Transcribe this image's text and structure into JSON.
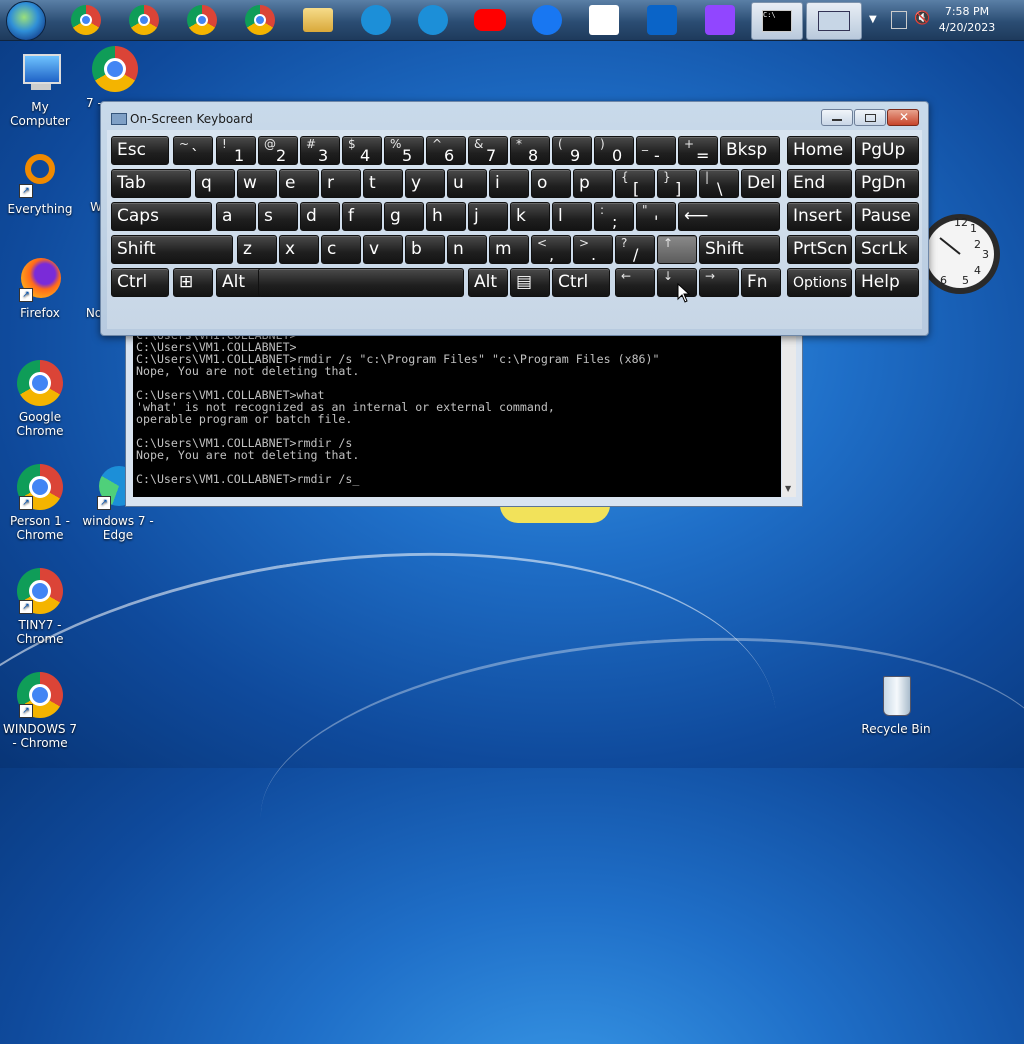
{
  "taskbar": {
    "clock_time": "7:58 PM",
    "clock_date": "4/20/2023",
    "pinned": [
      {
        "name": "chrome",
        "color": "#4285f4"
      },
      {
        "name": "chrome-profile",
        "color": "#4285f4"
      },
      {
        "name": "chrome-profile",
        "color": "#4285f4"
      },
      {
        "name": "chrome-profile",
        "color": "#4285f4"
      },
      {
        "name": "file-explorer",
        "color": "#e8c25a"
      },
      {
        "name": "edge",
        "color": "#1c8fd8"
      },
      {
        "name": "edge",
        "color": "#1c8fd8"
      },
      {
        "name": "youtube",
        "color": "#ff0000"
      },
      {
        "name": "facebook",
        "color": "#1877f2"
      },
      {
        "name": "amazon",
        "color": "#ffffff"
      },
      {
        "name": "outlook",
        "color": "#0a64c8"
      },
      {
        "name": "twitch",
        "color": "#9146ff"
      }
    ]
  },
  "desktop": {
    "icons": [
      {
        "label": "My Computer"
      },
      {
        "label": "7 -"
      },
      {
        "label": "Everything"
      },
      {
        "label": "W"
      },
      {
        "label": "Firefox"
      },
      {
        "label": "No"
      },
      {
        "label": "Google Chrome"
      },
      {
        "label": "Person 1 - Chrome"
      },
      {
        "label": "windows 7 - Edge"
      },
      {
        "label": "TINY7 - Chrome"
      },
      {
        "label": "WINDOWS 7 - Chrome"
      },
      {
        "label": "Recycle Bin"
      }
    ]
  },
  "clock_gadget": {
    "numbers": [
      "12",
      "1",
      "2",
      "3",
      "4",
      "5",
      "6"
    ]
  },
  "osk": {
    "title": "On-Screen Keyboard",
    "rows": [
      [
        {
          "main": "Esc"
        },
        {
          "shift": "~",
          "main": "`"
        },
        {
          "shift": "!",
          "main": "1"
        },
        {
          "shift": "@",
          "main": "2"
        },
        {
          "shift": "#",
          "main": "3"
        },
        {
          "shift": "$",
          "main": "4"
        },
        {
          "shift": "%",
          "main": "5"
        },
        {
          "shift": "^",
          "main": "6"
        },
        {
          "shift": "&",
          "main": "7"
        },
        {
          "shift": "*",
          "main": "8"
        },
        {
          "shift": "(",
          "main": "9"
        },
        {
          "shift": ")",
          "main": "0"
        },
        {
          "shift": "_",
          "main": "-"
        },
        {
          "shift": "+",
          "main": "="
        },
        {
          "main": "Bksp"
        },
        {
          "main": "Home"
        },
        {
          "main": "PgUp"
        }
      ],
      [
        {
          "main": "Tab"
        },
        {
          "main": "q"
        },
        {
          "main": "w"
        },
        {
          "main": "e"
        },
        {
          "main": "r"
        },
        {
          "main": "t"
        },
        {
          "main": "y"
        },
        {
          "main": "u"
        },
        {
          "main": "i"
        },
        {
          "main": "o"
        },
        {
          "main": "p"
        },
        {
          "shift": "{",
          "main": "["
        },
        {
          "shift": "}",
          "main": "]"
        },
        {
          "shift": "|",
          "main": "\\"
        },
        {
          "main": "Del"
        },
        {
          "main": "End"
        },
        {
          "main": "PgDn"
        }
      ],
      [
        {
          "main": "Caps"
        },
        {
          "main": "a"
        },
        {
          "main": "s"
        },
        {
          "main": "d"
        },
        {
          "main": "f"
        },
        {
          "main": "g"
        },
        {
          "main": "h"
        },
        {
          "main": "j"
        },
        {
          "main": "k"
        },
        {
          "main": "l"
        },
        {
          "shift": ":",
          "main": ";"
        },
        {
          "shift": "\"",
          "main": "'"
        },
        {
          "main": "⟵"
        },
        {
          "main": "Insert"
        },
        {
          "main": "Pause"
        }
      ],
      [
        {
          "main": "Shift"
        },
        {
          "main": "z"
        },
        {
          "main": "x"
        },
        {
          "main": "c"
        },
        {
          "main": "v"
        },
        {
          "main": "b"
        },
        {
          "main": "n"
        },
        {
          "main": "m"
        },
        {
          "shift": "<",
          "main": ","
        },
        {
          "shift": ">",
          "main": "."
        },
        {
          "shift": "?",
          "main": "/"
        },
        {
          "shift": "↑",
          "main": ""
        },
        {
          "main": "Shift"
        },
        {
          "main": "PrtScn"
        },
        {
          "main": "ScrLk"
        }
      ],
      [
        {
          "main": "Ctrl"
        },
        {
          "main": "⊞"
        },
        {
          "main": "Alt"
        },
        {
          "main": ""
        },
        {
          "main": "Alt"
        },
        {
          "main": "▤"
        },
        {
          "main": "Ctrl"
        },
        {
          "shift": "←",
          "main": ""
        },
        {
          "shift": "↓",
          "main": ""
        },
        {
          "shift": "→",
          "main": ""
        },
        {
          "main": "Fn"
        },
        {
          "main": "Options"
        },
        {
          "main": "Help"
        }
      ]
    ]
  },
  "cmd": {
    "lines": [
      "C:\\Users\\VM1.COLLABNET>",
      "C:\\Users\\VM1.COLLABNET>",
      "C:\\Users\\VM1.COLLABNET>rmdir /s \"c:\\Program Files\" \"c:\\Program Files (x86)\"",
      "Nope, You are not deleting that.",
      "",
      "C:\\Users\\VM1.COLLABNET>what",
      "'what' is not recognized as an internal or external command,",
      "operable program or batch file.",
      "",
      "C:\\Users\\VM1.COLLABNET>rmdir /s",
      "Nope, You are not deleting that.",
      "",
      "C:\\Users\\VM1.COLLABNET>rmdir /s_"
    ]
  }
}
